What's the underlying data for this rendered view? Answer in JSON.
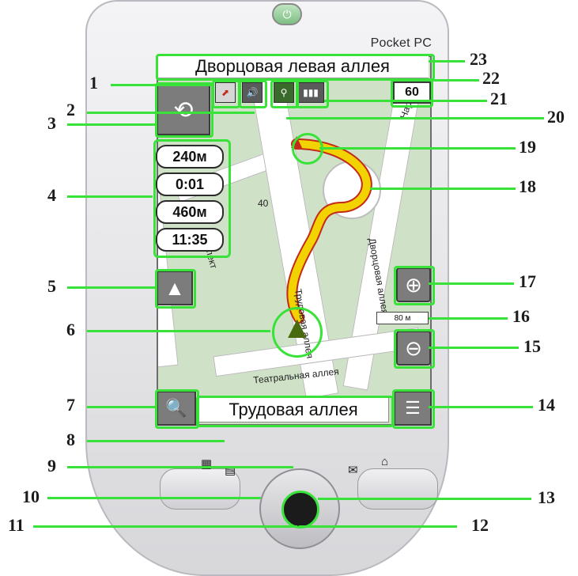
{
  "device": {
    "brand": "Pocket PC",
    "power_icon": "power-icon"
  },
  "screen": {
    "street_top": "Дворцовая левая аллея",
    "speed_limit": "60",
    "info_values": [
      "240м",
      "0:01",
      "460м",
      "11:35"
    ],
    "street_bottom": "Трудовая аллея",
    "scale_label": "80 м",
    "map_labels": {
      "top_right": "Нарышкина",
      "left": "Проспект",
      "center_road": "Трудовая аллея",
      "right_road": "Дворцовая аллея",
      "bottom": "Театральная аллея",
      "house_number": "40"
    },
    "toolbar_icons": [
      "compass-icon",
      "volume-icon",
      "gps-icon",
      "battery-icon"
    ]
  },
  "callouts": [
    "1",
    "2",
    "3",
    "4",
    "5",
    "6",
    "7",
    "8",
    "9",
    "10",
    "11",
    "12",
    "13",
    "14",
    "15",
    "16",
    "17",
    "18",
    "19",
    "20",
    "21",
    "22",
    "23"
  ],
  "colors": {
    "highlight": "#39e239",
    "route": "#f2d200",
    "route_outline": "#c32a19"
  }
}
